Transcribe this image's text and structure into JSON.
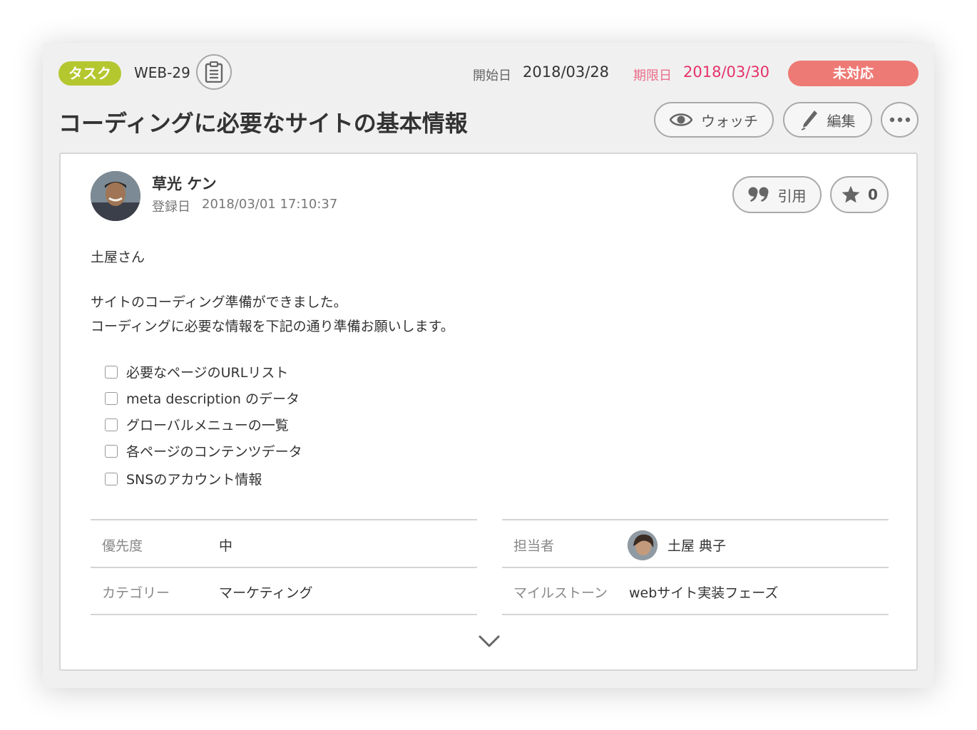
{
  "header": {
    "type_tag": "タスク",
    "issue_key": "WEB-29",
    "start_label": "開始日",
    "start_date": "2018/03/28",
    "due_label": "期限日",
    "due_date": "2018/03/30",
    "status": "未対応",
    "title": "コーディングに必要なサイトの基本情報",
    "watch_label": "ウォッチ",
    "edit_label": "編集"
  },
  "post": {
    "author": "草光 ケン",
    "registered_label": "登録日",
    "registered_at": "2018/03/01 17:10:37",
    "quote_label": "引用",
    "star_count": "0",
    "greeting": "土屋さん",
    "line1": "サイトのコーディング準備ができました。",
    "line2": "コーディングに必要な情報を下記の通り準備お願いします。",
    "checklist": [
      "必要なページのURLリスト",
      "meta description のデータ",
      "グローバルメニューの一覧",
      "各ページのコンテンツデータ",
      "SNSのアカウント情報"
    ]
  },
  "attributes": {
    "priority_label": "優先度",
    "priority_value": "中",
    "category_label": "カテゴリー",
    "category_value": "マーケティング",
    "assignee_label": "担当者",
    "assignee_value": "土屋 典子",
    "milestone_label": "マイルストーン",
    "milestone_value": "webサイト実装フェーズ"
  },
  "colors": {
    "type_tag": "#b5c72f",
    "status": "#ee7a75",
    "due_date": "#e5336a"
  },
  "icons": {
    "copy": "clipboard-icon",
    "watch": "eye-icon",
    "edit": "pencil-icon",
    "more": "ellipsis-icon",
    "quote": "quote-icon",
    "star": "star-icon",
    "expand": "chevron-down-icon"
  }
}
